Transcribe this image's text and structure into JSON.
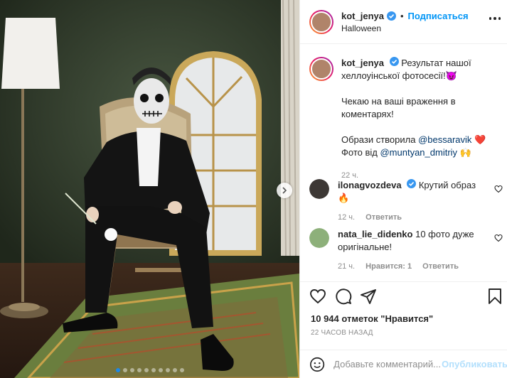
{
  "post": {
    "author": "kot_jenya",
    "verified": true,
    "separator": "•",
    "follow_label": "Подписаться",
    "location": "Halloween"
  },
  "caption": {
    "username": "kot_jenya",
    "line1": "Результат нашої хеллоуінської фотосесії!",
    "line1_emoji": "😈",
    "line2": "Чекаю на ваші враження в коментарях!",
    "line3_prefix": "Образи створила",
    "line3_mention": "@bessaravik",
    "line3_emoji": "❤️",
    "line4_prefix": "Фото від",
    "line4_mention": "@muntyan_dmitriy",
    "line4_emoji": "🙌",
    "time": "22 ч."
  },
  "comments": [
    {
      "username": "ilonagvozdeva",
      "verified": true,
      "text": "Крутий образ",
      "emoji": "🔥",
      "time": "12 ч.",
      "reply_label": "Ответить"
    },
    {
      "username": "nata_lie_didenko",
      "verified": false,
      "text": "10 фото дуже оригінальне!",
      "time": "21 ч.",
      "likes_label": "Нравится: 1",
      "reply_label": "Ответить"
    }
  ],
  "stats": {
    "likes_text": "10 944 отметок \"Нравится\"",
    "time_ago": "22 ЧАСОВ НАЗАД"
  },
  "add_comment": {
    "placeholder": "Добавьте комментарий...",
    "publish_label": "Опубликовать"
  },
  "carousel": {
    "total": 10,
    "active_index": 0
  },
  "colors": {
    "link": "#0095f6",
    "mention": "#00376b",
    "muted": "#8e8e8e",
    "publish_disabled": "#b2dffc",
    "active_dot": "#1e88e5"
  },
  "icons": [
    "verified-icon",
    "more-options-icon",
    "heart-icon",
    "comment-icon",
    "share-icon",
    "bookmark-icon",
    "emoji-icon",
    "next-arrow-icon"
  ]
}
